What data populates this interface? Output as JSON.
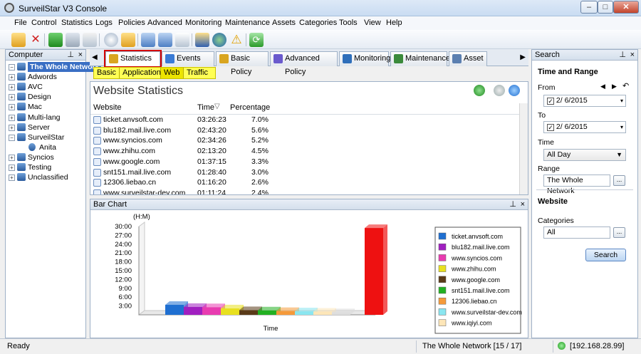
{
  "window": {
    "title": "SurveilStar V3 Console",
    "minimize": "–",
    "maximize": "□",
    "close": "✕"
  },
  "menu": [
    "File",
    "Control",
    "Statistics",
    "Logs",
    "Policies",
    "Advanced",
    "Monitoring",
    "Maintenance",
    "Assets",
    "Categories",
    "Tools",
    "View",
    "Help"
  ],
  "toolbar_icons": [
    "new-folder-icon",
    "delete-icon",
    "import-icon",
    "export-icon",
    "print-icon",
    "print-preview-icon",
    "globe-icon",
    "search-folder-icon",
    "copy-icon",
    "paste-icon",
    "document-icon",
    "alert-icon",
    "network-icon",
    "warning-icon",
    "refresh-icon"
  ],
  "left_panel": {
    "title": "Computer",
    "tree": [
      {
        "label": "The Whole Network",
        "level": 0,
        "root": true
      },
      {
        "label": "Adwords",
        "level": 1
      },
      {
        "label": "AVC",
        "level": 1
      },
      {
        "label": "Design",
        "level": 1
      },
      {
        "label": "Mac",
        "level": 1
      },
      {
        "label": "Multi-lang",
        "level": 1
      },
      {
        "label": "Server",
        "level": 1
      },
      {
        "label": "SurveilStar",
        "level": 1
      },
      {
        "label": "Anita",
        "level": 2
      },
      {
        "label": "Syncios",
        "level": 1
      },
      {
        "label": "Testing",
        "level": 1
      },
      {
        "label": "Unclassified",
        "level": 1
      }
    ]
  },
  "tabs": [
    {
      "label": "Statistics",
      "active": true,
      "color": "#d9a520"
    },
    {
      "label": "Events Log",
      "color": "#3a7bd5"
    },
    {
      "label": "Basic Policy",
      "color": "#d9a520"
    },
    {
      "label": "Advanced Policy",
      "color": "#6a5acd"
    },
    {
      "label": "Monitoring",
      "color": "#2f6fba"
    },
    {
      "label": "Maintenance",
      "color": "#3b8a3b"
    },
    {
      "label": "Asset",
      "color": "#5b7fb0"
    }
  ],
  "subtabs": [
    {
      "label": "Basic"
    },
    {
      "label": "Application"
    },
    {
      "label": "Web",
      "active": true
    },
    {
      "label": "Traffic"
    }
  ],
  "stats": {
    "title": "Website Statistics",
    "columns": {
      "website": "Website",
      "time": "Time",
      "percentage": "Percentage"
    },
    "rows": [
      {
        "site": "ticket.anvsoft.com",
        "time": "03:26:23",
        "pct": "7.0%"
      },
      {
        "site": "blu182.mail.live.com",
        "time": "02:43:20",
        "pct": "5.6%"
      },
      {
        "site": "www.syncios.com",
        "time": "02:34:26",
        "pct": "5.2%"
      },
      {
        "site": "www.zhihu.com",
        "time": "02:13:20",
        "pct": "4.5%"
      },
      {
        "site": "www.google.com",
        "time": "01:37:15",
        "pct": "3.3%"
      },
      {
        "site": "snt151.mail.live.com",
        "time": "01:28:40",
        "pct": "3.0%"
      },
      {
        "site": "12306.liebao.cn",
        "time": "01:16:20",
        "pct": "2.6%"
      },
      {
        "site": "www.surveilstar-dev.com",
        "time": "01:11:24",
        "pct": "2.4%"
      }
    ]
  },
  "chart_panel": {
    "title": "Bar Chart"
  },
  "chart_data": {
    "type": "bar",
    "unit_label": "(H:M)",
    "xlabel": "Time",
    "yticks": [
      "30:00",
      "27:00",
      "24:00",
      "21:00",
      "18:00",
      "15:00",
      "12:00",
      "9:00",
      "6:00",
      "3:00"
    ],
    "ylim": [
      0,
      30
    ],
    "categories": [
      "ticket.anvsoft.com",
      "blu182.mail.live.com",
      "www.syncios.com",
      "www.zhihu.com",
      "www.google.com",
      "snt151.mail.live.com",
      "12306.liebao.cn",
      "www.surveilstar-dev.com",
      "www.iqiyi.com",
      "",
      ""
    ],
    "values": [
      3.4,
      2.7,
      2.6,
      2.2,
      1.6,
      1.5,
      1.3,
      1.2,
      1.1,
      0.9,
      29.5
    ],
    "colors": [
      "#1f6fd1",
      "#a01fc0",
      "#e83cb0",
      "#e8e01f",
      "#5a3a18",
      "#22b022",
      "#f59a3a",
      "#8ae6f0",
      "#fde6b8",
      "#dddddd",
      "#ee1111"
    ],
    "legend_position": "right",
    "legend": [
      {
        "label": "ticket.anvsoft.com",
        "color": "#1f6fd1"
      },
      {
        "label": "blu182.mail.live.com",
        "color": "#a01fc0"
      },
      {
        "label": "www.syncios.com",
        "color": "#e83cb0"
      },
      {
        "label": "www.zhihu.com",
        "color": "#e8e01f"
      },
      {
        "label": "www.google.com",
        "color": "#5a3a18"
      },
      {
        "label": "snt151.mail.live.com",
        "color": "#22b022"
      },
      {
        "label": "12306.liebao.cn",
        "color": "#f59a3a"
      },
      {
        "label": "www.surveilstar-dev.com",
        "color": "#8ae6f0"
      },
      {
        "label": "www.iqiyi.com",
        "color": "#fde6b8"
      }
    ]
  },
  "search_panel": {
    "title": "Search",
    "time_range": "Time and Range",
    "from_label": "From",
    "from_value": "2/  6/2015",
    "to_label": "To",
    "to_value": "2/  6/2015",
    "time_label": "Time",
    "time_value": "All Day",
    "range_label": "Range",
    "range_value": "The Whole Network",
    "website_heading": "Website",
    "categories_label": "Categories",
    "categories_value": "All",
    "browse": "...",
    "search_button": "Search"
  },
  "status": {
    "left": "Ready",
    "network": "The Whole Network [15 / 17]",
    "ip": "[192.168.28.99]"
  }
}
